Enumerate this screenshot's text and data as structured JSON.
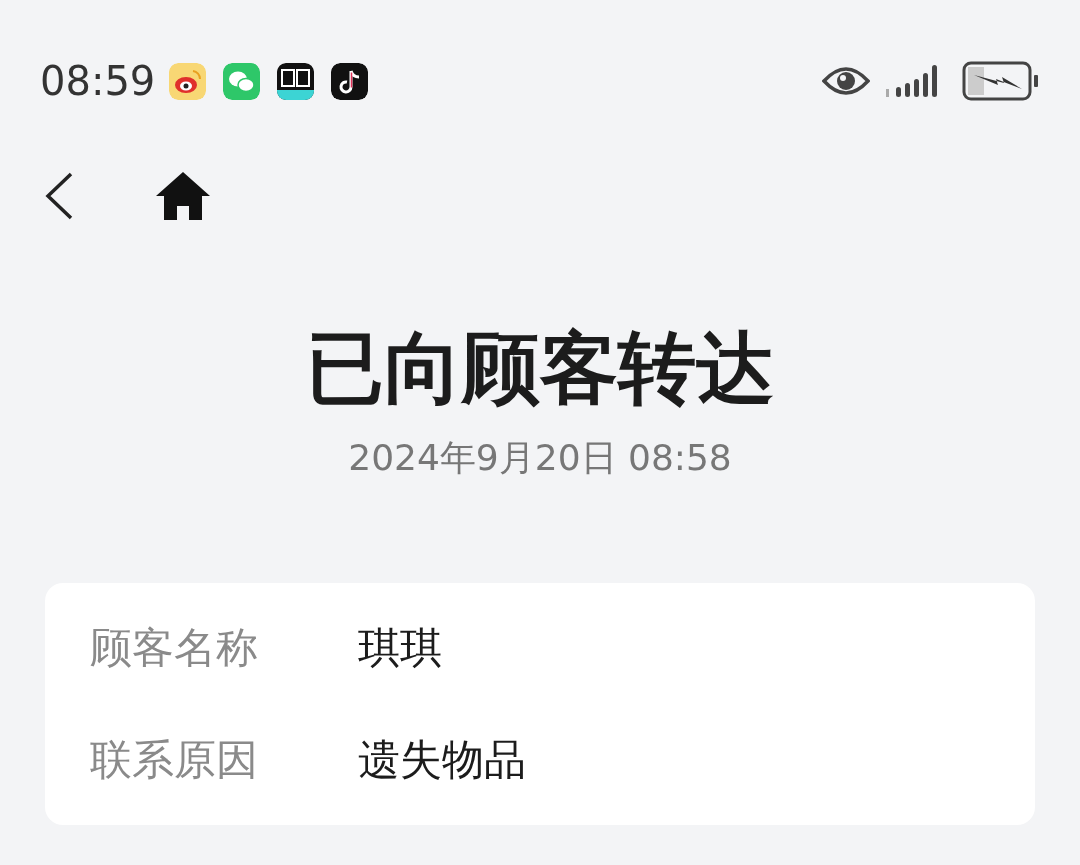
{
  "status_bar": {
    "time": "08:59"
  },
  "title": "已向顾客转达",
  "timestamp": "2024年9月20日 08:58",
  "details": [
    {
      "label": "顾客名称",
      "value": "琪琪"
    },
    {
      "label": "联系原因",
      "value": "遗失物品"
    }
  ]
}
